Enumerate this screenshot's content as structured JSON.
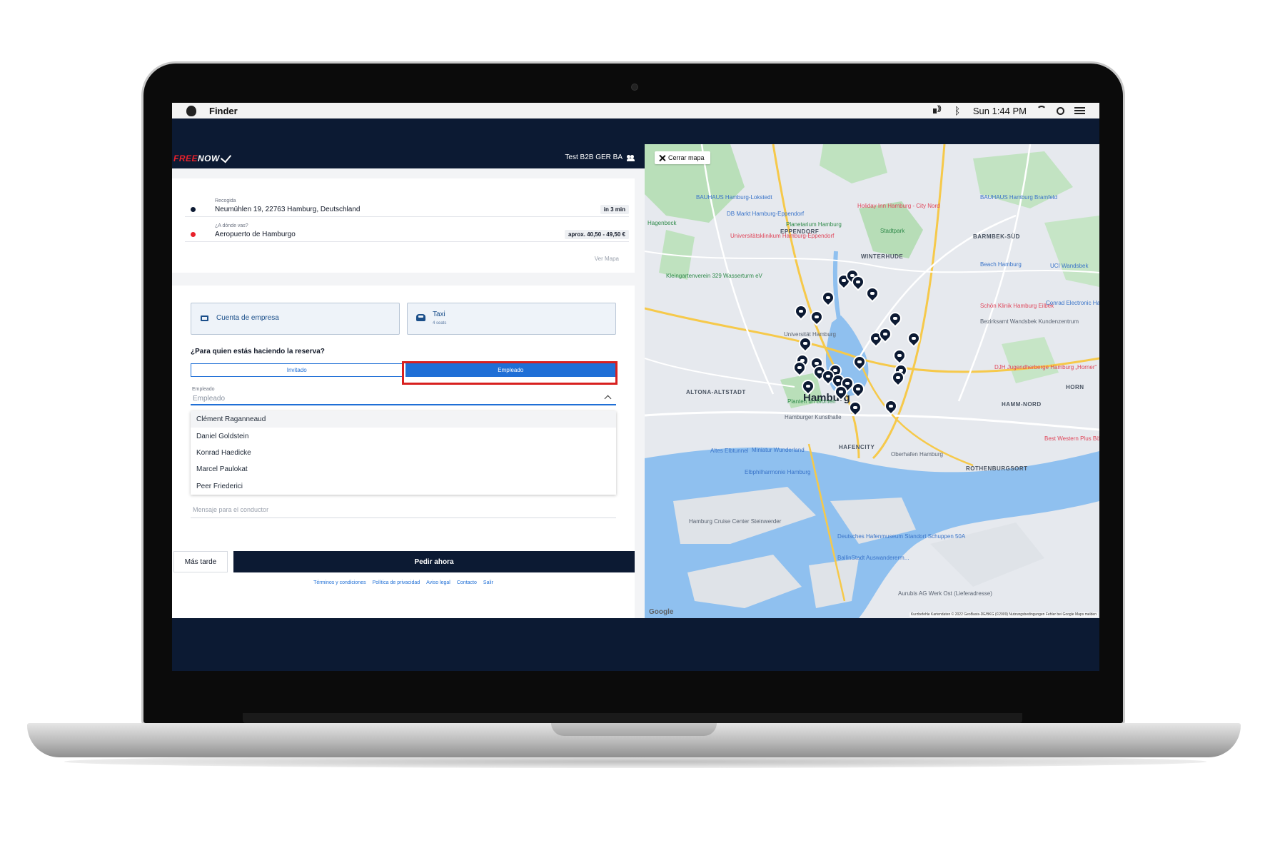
{
  "menubar": {
    "app_name": "Finder",
    "clock": "Sun 1:44 PM"
  },
  "header": {
    "logo_free": "FREE",
    "logo_now": "NOW",
    "account": "Test B2B GER BA"
  },
  "route": {
    "pickup_label": "Recogida",
    "pickup_value": "Neumühlen 19, 22763 Hamburg, Deutschland",
    "pickup_eta": "in 3 min",
    "dest_label": "¿A dónde vas?",
    "dest_value": "Aeropuerto de Hamburgo",
    "dest_price": "aprox. 40,50 - 49,50 €",
    "ver_mapa": "Ver Mapa"
  },
  "options": {
    "payment_label": "Cuenta de empresa",
    "vehicle_label": "Taxi",
    "vehicle_sub": "4 seats"
  },
  "booking_for": {
    "question": "¿Para quien estás haciendo la reserva?",
    "guest": "Invitado",
    "employee": "Empleado",
    "selected": "Empleado"
  },
  "employee_field": {
    "label": "Empleado",
    "placeholder": "Empleado",
    "options": [
      "Clément Raganneaud",
      "Daniel Goldstein",
      "Konrad Haedicke",
      "Marcel Paulokat",
      "Peer Friederici"
    ]
  },
  "message_placeholder": "Mensaje para el conductor",
  "actions": {
    "later": "Más tarde",
    "now": "Pedir ahora"
  },
  "footer_links": [
    "Términos y condiciones",
    "Política de privacidad",
    "Aviso legal",
    "Contacto",
    "Salir"
  ],
  "map": {
    "close_label": "Cerrar mapa",
    "city": "Hamburg",
    "districts": [
      "WINTERHUDE",
      "ALTONA-ALTSTADT",
      "HAFENCITY",
      "HORN",
      "EPPENDORF",
      "BARMBEK-SÜD",
      "ROTHENBURGSORT",
      "HAMM-NORD"
    ],
    "pois": {
      "red": [
        "Holiday Inn Hamburg - City Nord",
        "Universitätsklinikum Hamburg-Eppendorf",
        "Schön Klinik Hamburg Eilbek",
        "DJH Jugendherberge Hamburg „Horner“",
        "Best Western Plus Böttcherhof Hamburg"
      ],
      "blue": [
        "BAUHAUS Hamburg-Lokstedt",
        "DB Markt Hamburg-Eppendorf",
        "BAUHAUS Hamburg Bramfeld",
        "Beach Hamburg",
        "UCI Wandsbek",
        "Conrad Electronic Hamburg",
        "Bezirksamt Wandsbek Kundenzentrum",
        "Miniatur Wunderland",
        "Elbphilharmonie Hamburg",
        "Altes Elbtunnel",
        "Deutsches Hafenmuseum Standort Schuppen 50A",
        "BallinStadt Auswandererm..."
      ],
      "green": [
        "Planetarium Hamburg",
        "Stadtpark",
        "Planten un Blomen",
        "Kleingartenverein 329 Wasserturm eV",
        "Hagenbeck"
      ],
      "gray": [
        "Universität Hamburg",
        "Hamburger Kunsthalle",
        "Hamburg Cruise Center Steinwerder",
        "Aurubis AG Werk Ost (Lieferadresse)",
        "Oberhafen Hamburg"
      ]
    },
    "attribution": "Kurzbefehle  Kartendaten © 2022 GeoBasis-DE/BKG (©2009)  Nutzungsbedingungen  Fehler bei Google Maps melden",
    "google": "Google"
  }
}
